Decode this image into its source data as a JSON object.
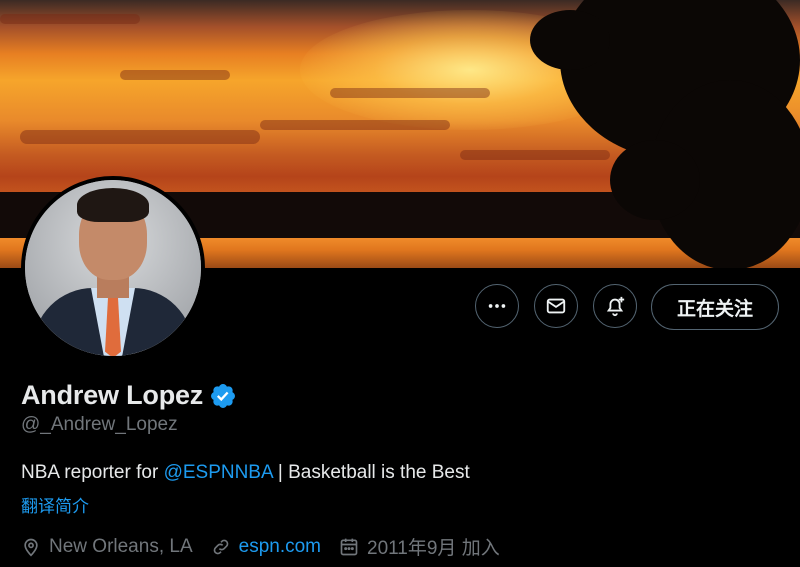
{
  "banner": {
    "description_icon": "sunset-banner"
  },
  "profile": {
    "name": "Andrew Lopez",
    "verified": true,
    "handle": "@_Andrew_Lopez",
    "bio_prefix": "NBA reporter for ",
    "bio_link": "@ESPNNBA",
    "bio_suffix": " | Basketball is the Best",
    "translate_label": "翻译简介",
    "location": "New Orleans, LA",
    "website": "espn.com",
    "joined": "2011年9月 加入"
  },
  "actions": {
    "more_icon": "more-icon",
    "message_icon": "mail-icon",
    "notify_icon": "bell-plus-icon",
    "follow_label": "正在关注"
  },
  "colors": {
    "accent": "#1d9bf0",
    "background": "#000000",
    "secondary_text": "#71767b",
    "primary_text": "#e7e9ea"
  }
}
